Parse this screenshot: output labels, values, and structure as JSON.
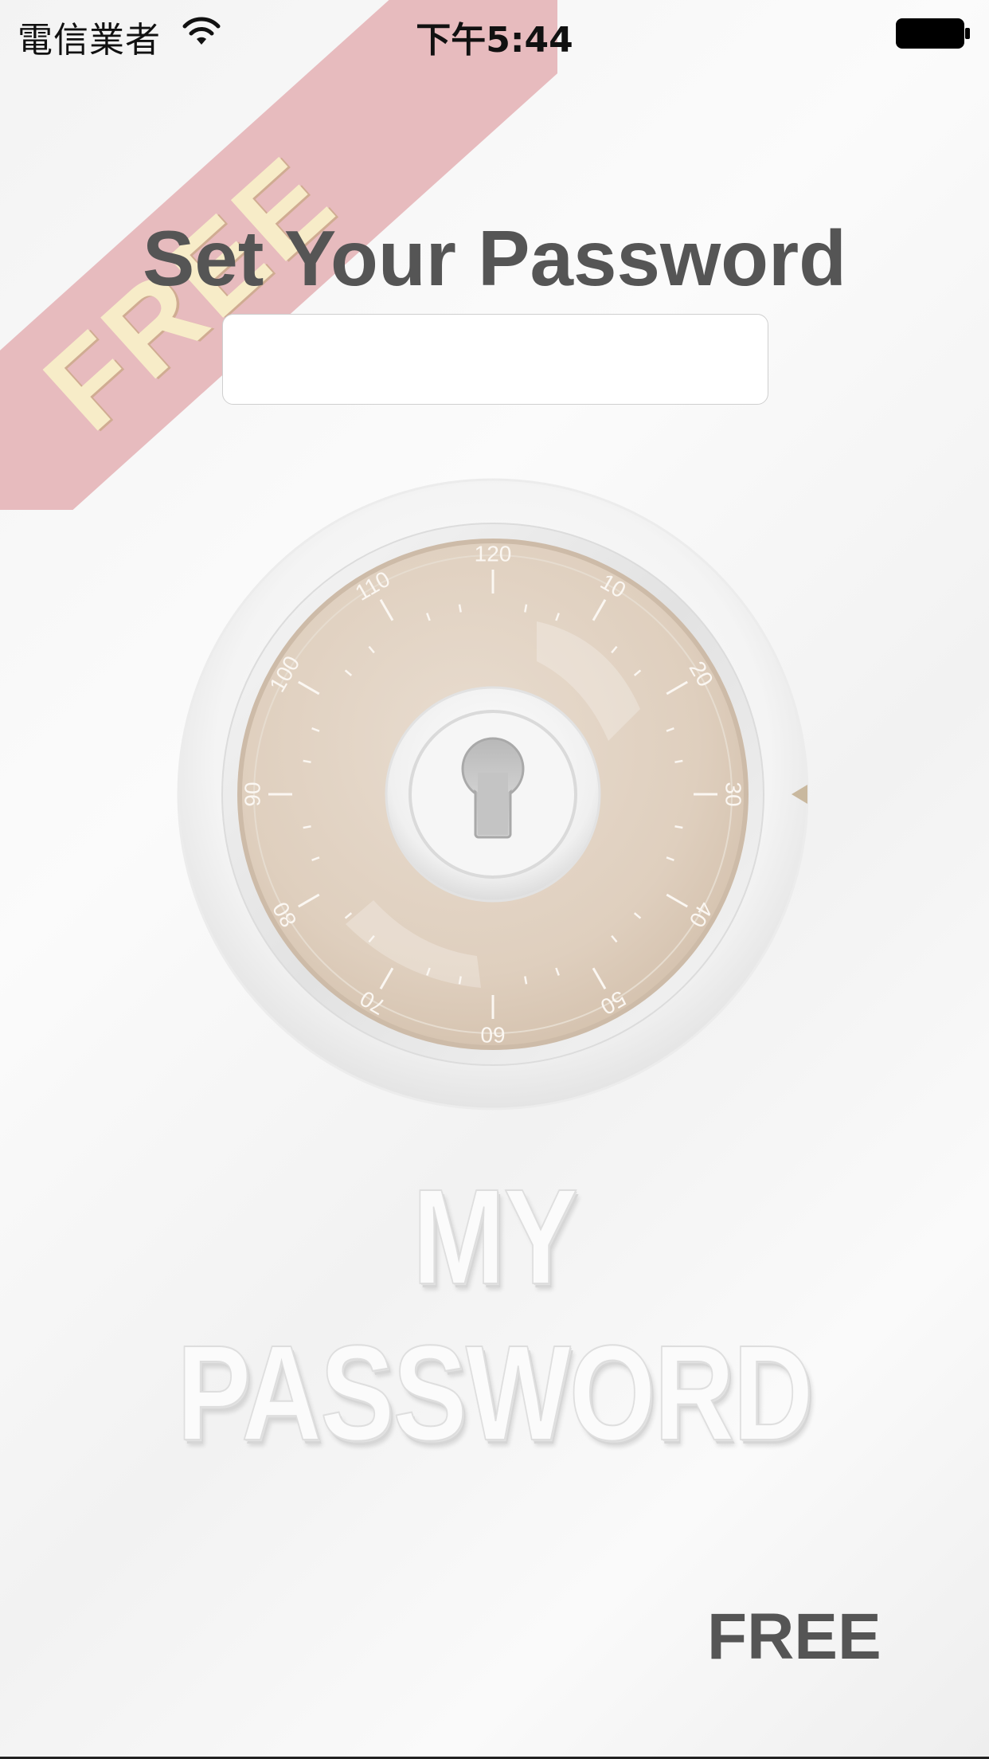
{
  "status_bar": {
    "carrier": "電信業者",
    "time": "下午5:44",
    "wifi_icon": "wifi-icon",
    "battery_icon": "battery-icon"
  },
  "ribbon": {
    "label": "FREE",
    "color": "#dd969b"
  },
  "title": "Set Your Password",
  "password_field": {
    "value": "",
    "placeholder": ""
  },
  "dial": {
    "tick_labels": [
      "120",
      "10",
      "20",
      "30",
      "40",
      "50",
      "60",
      "70",
      "80",
      "90",
      "100",
      "110"
    ],
    "center_icon": "keyhole-icon",
    "pointer_icon": "triangle-pointer-icon",
    "face_color": "#dfcfbe"
  },
  "logo": "MY PASSWORD",
  "free_label": "FREE"
}
